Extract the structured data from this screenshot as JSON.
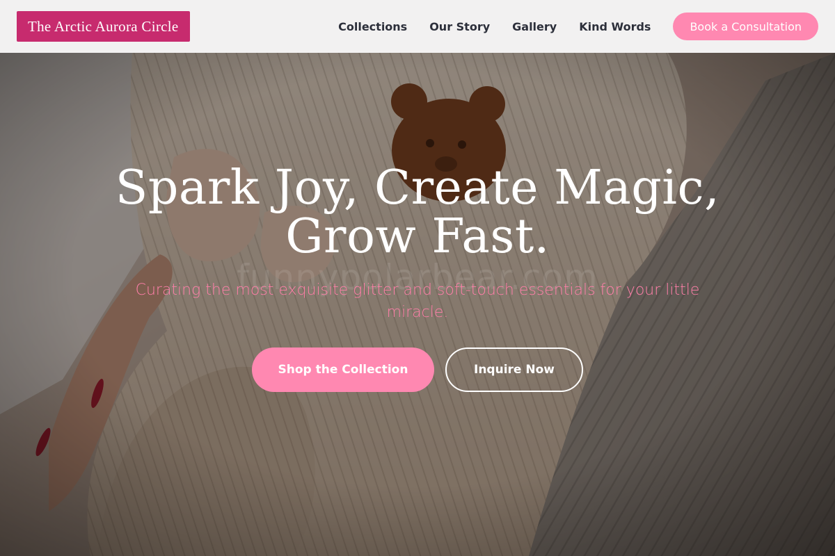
{
  "header": {
    "logo_text": "The Arctic Aurora Circle",
    "nav": [
      {
        "label": "Collections"
      },
      {
        "label": "Our Story"
      },
      {
        "label": "Gallery"
      },
      {
        "label": "Kind Words"
      }
    ],
    "cta_label": "Book a Consultation"
  },
  "hero": {
    "title_line1": "Spark Joy, Create Magic,",
    "title_line2": "Grow Fast.",
    "subtitle": "Curating the most exquisite glitter and soft-touch essentials for your little miracle.",
    "watermark": "funnypolarbear.com",
    "primary_button": "Shop the Collection",
    "secondary_button": "Inquire Now",
    "photo_icon": "baby-knit-sweater-photo"
  },
  "colors": {
    "brand": "#c72b6e",
    "accent_pink": "#ff88b1",
    "subtitle_pink": "#ff7fa9",
    "nav_text": "#2c2f3a",
    "header_bg": "#f2f1f1"
  }
}
